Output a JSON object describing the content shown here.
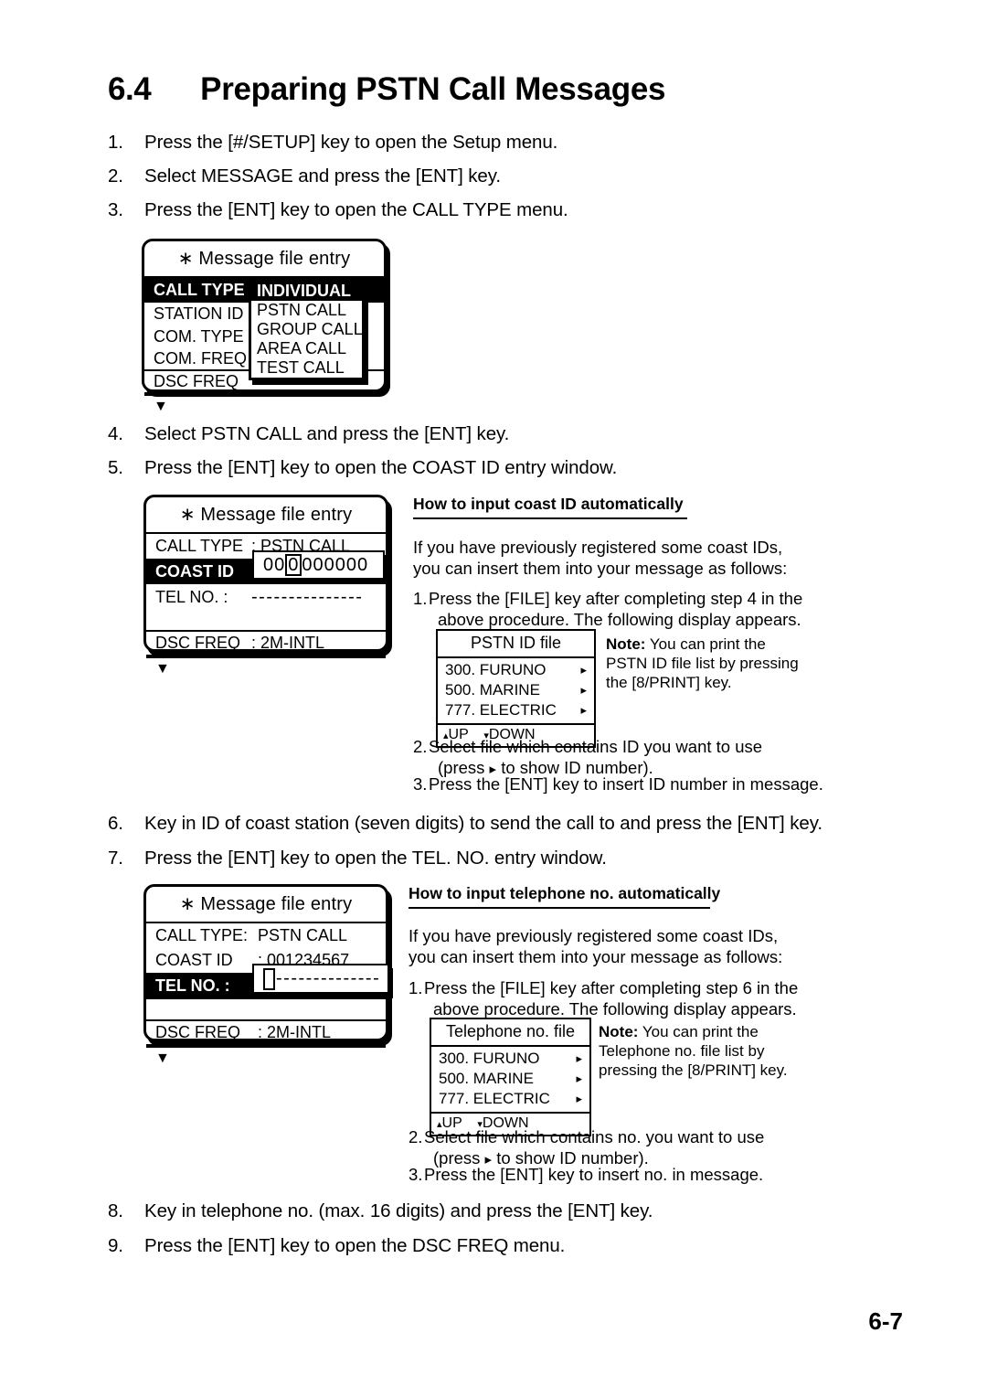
{
  "title": {
    "number": "6.4",
    "text": "Preparing PSTN Call Messages"
  },
  "page_number": "6-7",
  "steps": [
    {
      "num": "1.",
      "text": "Press the [#/SETUP] key to open the Setup menu."
    },
    {
      "num": "2.",
      "text": "Select MESSAGE and press the [ENT] key."
    },
    {
      "num": "3.",
      "text": "Press the [ENT] key to open the CALL TYPE menu."
    },
    {
      "num": "4.",
      "text": "Select PSTN CALL and press the [ENT] key."
    },
    {
      "num": "5.",
      "text": "Press the [ENT] key to open the COAST ID entry window."
    },
    {
      "num": "6.",
      "text": "Key in ID of coast station (seven digits) to send the call to and press the [ENT] key."
    },
    {
      "num": "7.",
      "text": "Press the [ENT] key to open the TEL. NO. entry window."
    },
    {
      "num": "8.",
      "text": "Key in telephone no. (max. 16 digits) and press the [ENT] key."
    },
    {
      "num": "9.",
      "text": "Press the [ENT] key to open the DSC FREQ menu."
    }
  ],
  "lcd1": {
    "title": "∗ Message file entry",
    "rows": [
      {
        "label": "CALL  TYPE",
        "value": ""
      },
      {
        "label": "STATION ID",
        "value": ""
      },
      {
        "label": "COM. TYPE",
        "value": ""
      },
      {
        "label": "COM. FREQ",
        "value": ""
      },
      {
        "label": "DSC  FREQ",
        "value": ""
      }
    ],
    "footer": "▼",
    "popup": {
      "items": [
        "INDIVIDUAL",
        "PSTN CALL",
        "GROUP CALL",
        "AREA CALL",
        "TEST CALL"
      ],
      "selected": "INDIVIDUAL"
    }
  },
  "lcd2": {
    "title": "∗ Message file entry",
    "rows": [
      {
        "label": "CALL  TYPE",
        "value": ": PSTN CALL"
      },
      {
        "label": "COAST ID",
        "value": ""
      },
      {
        "label": "TEL NO. :",
        "value": "---------------"
      },
      {
        "label": "",
        "value": ""
      },
      {
        "label": "DSC  FREQ",
        "value": ": 2M-INTL"
      }
    ],
    "footer": "▼",
    "entry_value": "000000000",
    "cursor_index": 2
  },
  "lcd3": {
    "title": "∗ Message file entry",
    "rows": [
      {
        "label": "CALL  TYPE:",
        "value": "PSTN CALL"
      },
      {
        "label": "COAST ID",
        "value": ": 001234567"
      },
      {
        "label": "TEL NO. :",
        "value": ""
      },
      {
        "label": "",
        "value": ""
      },
      {
        "label": "DSC  FREQ",
        "value": ": 2M-INTL"
      }
    ],
    "footer": "▼",
    "entry_dashes": "--------------"
  },
  "howto_coast": {
    "heading": "How to input coast ID automatically",
    "intro_line1": "If you have previously registered some coast IDs,",
    "intro_line2": "you can insert them into your message as follows:",
    "step1_num": "1.",
    "step1_line1": "Press the [FILE] key after completing step 4 in the",
    "step1_line2": "above procedure. The following display appears.",
    "step2_num": "2.",
    "step2_line1": "Select file which contains ID you want to use",
    "step2_line2_pre": "(press",
    "step2_arrow": "▸",
    "step2_line2_post": "to show ID number).",
    "step3_num": "3.",
    "step3_line1": "Press the [ENT] key to insert ID number in message.",
    "filebox": {
      "title": "PSTN ID file",
      "items": [
        {
          "label": "300. FURUNO",
          "arrow": "▸"
        },
        {
          "label": "500.  MARINE",
          "arrow": "▸"
        },
        {
          "label": "777. ELECTRIC",
          "arrow": "▸"
        }
      ],
      "foot_up": "UP",
      "foot_down": "DOWN",
      "up_tri": "▴",
      "down_tri": "▾"
    },
    "note": {
      "label": "Note:",
      "line1": " You can print the",
      "line2": "PSTN ID file list by pressing",
      "line3": "the [8/PRINT] key."
    }
  },
  "howto_tel": {
    "heading": "How to input telephone no.  automatically",
    "intro_line1": "If you have previously registered some coast IDs,",
    "intro_line2": "you can insert them into your message as follows:",
    "step1_num": "1.",
    "step1_line1": "Press the [FILE] key after completing step 6 in the",
    "step1_line2": "above procedure. The following display appears.",
    "step2_num": "2.",
    "step2_line1": "Select file which contains no. you want to use",
    "step2_line2_pre": "(press",
    "step2_arrow": "▸",
    "step2_line2_post": "to show ID number).",
    "step3_num": "3.",
    "step3_line1": "Press the [ENT] key to insert no. in message.",
    "filebox": {
      "title": "Telephone no. file",
      "items": [
        {
          "label": "300. FURUNO",
          "arrow": "▸"
        },
        {
          "label": "500.  MARINE",
          "arrow": "▸"
        },
        {
          "label": "777. ELECTRIC",
          "arrow": "▸"
        }
      ],
      "foot_up": "UP",
      "foot_down": "DOWN",
      "up_tri": "▴",
      "down_tri": "▾"
    },
    "note": {
      "label": "Note:",
      "line1": " You can print the",
      "line2": "Telephone no.  file list by",
      "line3": "pressing the [8/PRINT] key."
    }
  }
}
